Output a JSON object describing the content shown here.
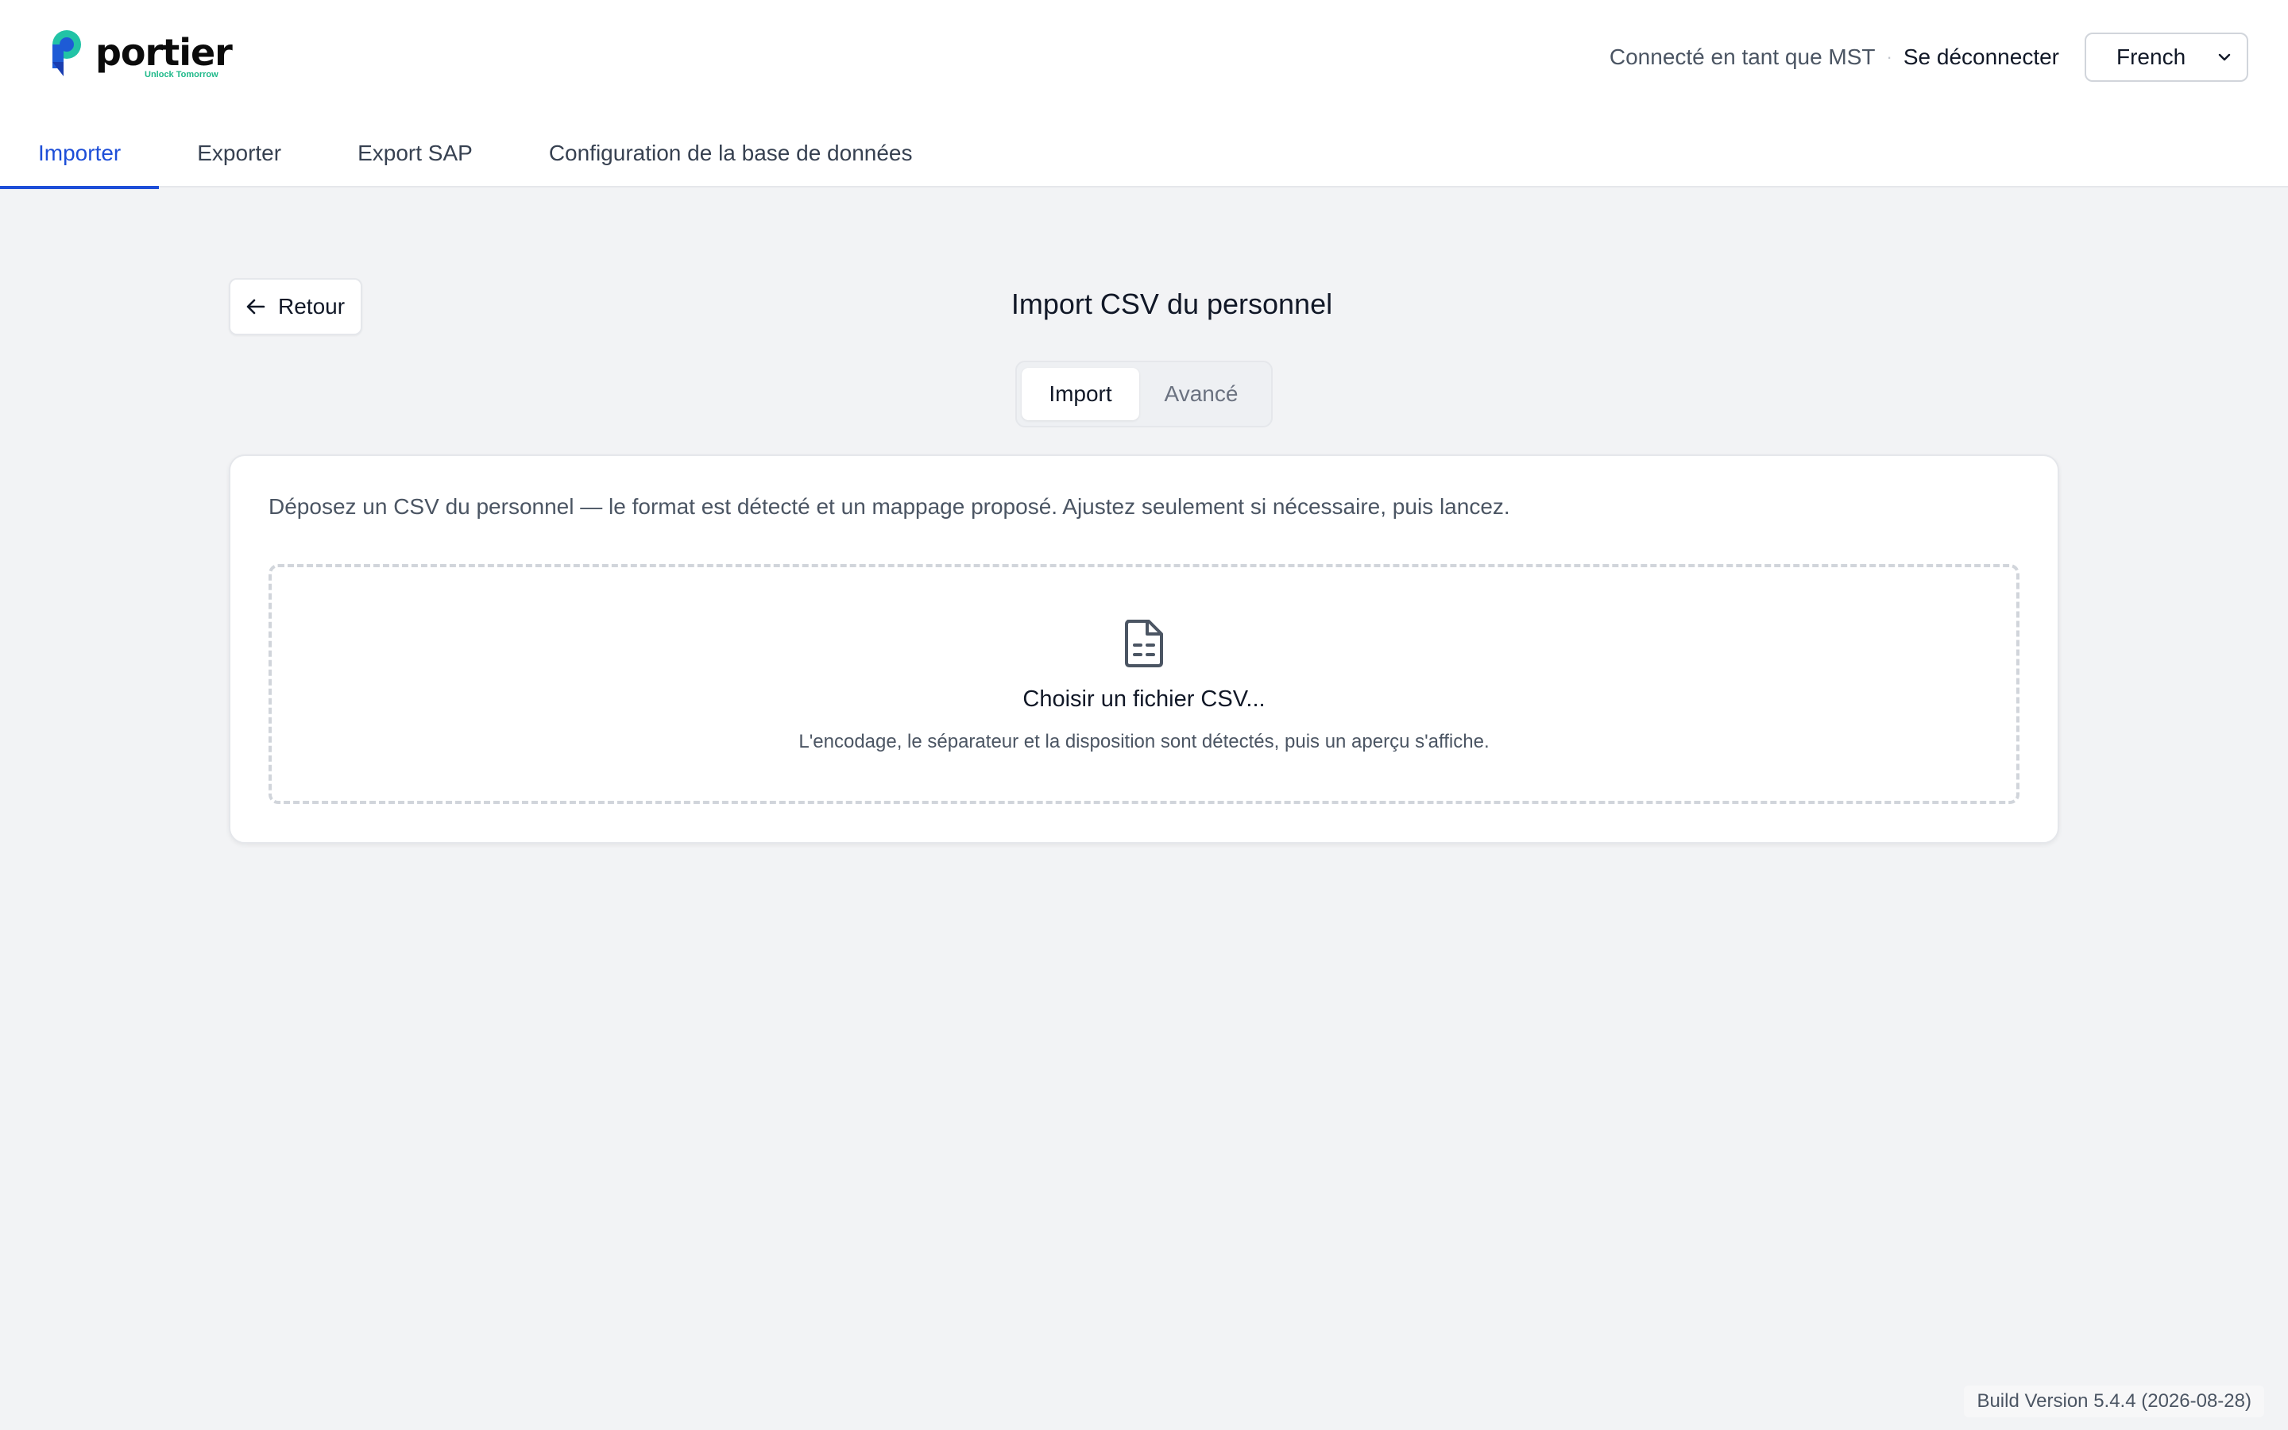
{
  "brand": {
    "name": "portier",
    "tagline": "Unlock Tomorrow",
    "logo_icon": "portier-logo-icon",
    "colors": {
      "logo_blue": "#1e5bd6",
      "logo_teal": "#22c3a6",
      "accent": "#1d4ed8"
    }
  },
  "header": {
    "connected_label": "Connecté en tant que MST",
    "logout_label": "Se déconnecter",
    "language": {
      "selected": "French",
      "icon": "chevron-down-icon"
    }
  },
  "nav": {
    "tabs": [
      {
        "label": "Importer",
        "active": true
      },
      {
        "label": "Exporter",
        "active": false
      },
      {
        "label": "Export SAP",
        "active": false
      },
      {
        "label": "Configuration de la base de données",
        "active": false
      }
    ]
  },
  "main": {
    "back_label": "Retour",
    "back_icon": "arrow-left-icon",
    "title": "Import CSV du personnel",
    "modes": [
      {
        "label": "Import",
        "selected": true
      },
      {
        "label": "Avancé",
        "selected": false
      }
    ],
    "description": "Déposez un CSV du personnel — le format est détecté et un mappage proposé. Ajustez seulement si nécessaire, puis lancez.",
    "dropzone": {
      "icon": "file-spreadsheet-icon",
      "title": "Choisir un fichier CSV...",
      "hint": "L'encodage, le séparateur et la disposition sont détectés, puis un aperçu s'affiche."
    }
  },
  "footer": {
    "build": "Build Version 5.4.4 (2026-08-28)"
  }
}
